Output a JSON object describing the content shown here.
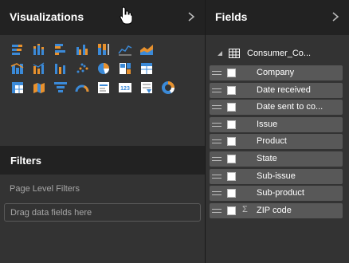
{
  "visualizations": {
    "title": "Visualizations"
  },
  "filters": {
    "title": "Filters",
    "page_level_label": "Page Level Filters",
    "drop_placeholder": "Drag data fields here"
  },
  "fields": {
    "title": "Fields",
    "table_name": "Consumer_Co...",
    "items": [
      {
        "label": "Company",
        "sigma": ""
      },
      {
        "label": "Date received",
        "sigma": ""
      },
      {
        "label": "Date sent to co...",
        "sigma": ""
      },
      {
        "label": "Issue",
        "sigma": ""
      },
      {
        "label": "Product",
        "sigma": ""
      },
      {
        "label": "State",
        "sigma": ""
      },
      {
        "label": "Sub-issue",
        "sigma": ""
      },
      {
        "label": "Sub-product",
        "sigma": ""
      },
      {
        "label": "ZIP code",
        "sigma": "Σ"
      }
    ]
  },
  "viz_icons": [
    [
      "stacked-bar-chart-icon",
      "stacked-column-chart-icon",
      "clustered-bar-chart-icon",
      "clustered-column-chart-icon",
      "100-percent-stacked-bar-icon",
      "line-chart-icon",
      "area-chart-icon"
    ],
    [
      "stacked-area-icon",
      "line-column-combo-icon",
      "ribbon-chart-icon",
      "scatter-chart-icon",
      "pie-chart-icon",
      "treemap-icon",
      "table-grid-icon"
    ],
    [
      "matrix-icon",
      "filled-map-icon",
      "funnel-icon",
      "gauge-icon",
      "card-icon",
      "multi-row-card-icon",
      "slicer-icon",
      "donut-chart-icon"
    ]
  ],
  "colors": {
    "accent": "#f2c811",
    "blue": "#3b8ad8",
    "orange": "#e8912d",
    "field_bg": "#585858",
    "header_bg": "#222222"
  }
}
